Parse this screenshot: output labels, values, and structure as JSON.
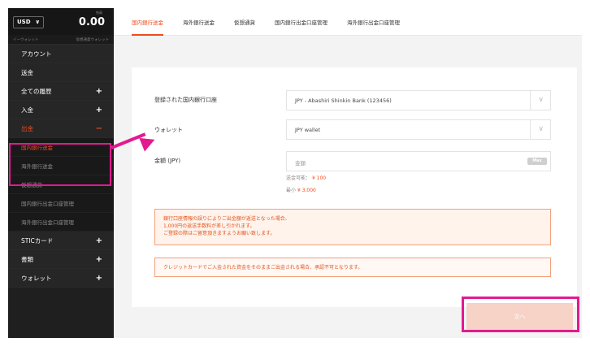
{
  "sidebar": {
    "currency": "USD",
    "balance_label": "残高",
    "balance": "0.00",
    "sub_left": "イーウォレット",
    "sub_right": "仮想通貨ウォレット",
    "items": [
      {
        "label": "アカウント"
      },
      {
        "label": "送金"
      },
      {
        "label": "全ての履歴",
        "expand": "+"
      },
      {
        "label": "入金",
        "expand": "+"
      },
      {
        "label": "出金",
        "expand": "−"
      }
    ],
    "withdraw_sub": [
      {
        "label": "国内銀行送金"
      },
      {
        "label": "海外銀行送金"
      },
      {
        "label": "仮想通貨"
      },
      {
        "label": "国内銀行出金口座管理"
      },
      {
        "label": "海外銀行出金口座管理"
      }
    ],
    "bottom_items": [
      {
        "label": "STICカード",
        "expand": "+"
      },
      {
        "label": "書類",
        "expand": "+"
      },
      {
        "label": "ウォレット",
        "expand": "+"
      }
    ]
  },
  "tabs": [
    {
      "label": "国内銀行送金"
    },
    {
      "label": "海外銀行送金"
    },
    {
      "label": "仮想通貨"
    },
    {
      "label": "国内銀行出金口座管理"
    },
    {
      "label": "海外銀行出金口座管理"
    }
  ],
  "form": {
    "bank_label": "登録された国内銀行口座",
    "bank_value": "JPY - Abashiri Shinkin Bank (123456)",
    "wallet_label": "ウォレット",
    "wallet_value": "JPY wallet",
    "amount_label": "金額 (JPY)",
    "amount_placeholder": "金額",
    "max_label": "Max",
    "available_label": "送金可能：",
    "available_value": "¥ 100",
    "min_label": "最小",
    "min_value": "¥ 3,000"
  },
  "notices": {
    "bank_info_line1": "銀行口座情報の誤りによりご出金額が返送となった場合、",
    "bank_info_line2": "1,000円の返送手数料が差し引かれます。",
    "bank_info_line3": "ご登録の際はご留意頂きますようお願い致します。",
    "credit_card": "クレジットカードでご入金された資金をそのままご出金される場合、承認不可となります。"
  },
  "next_button": "次へ",
  "colors": {
    "accent": "#f24b1e",
    "highlight": "#e31a8f"
  }
}
